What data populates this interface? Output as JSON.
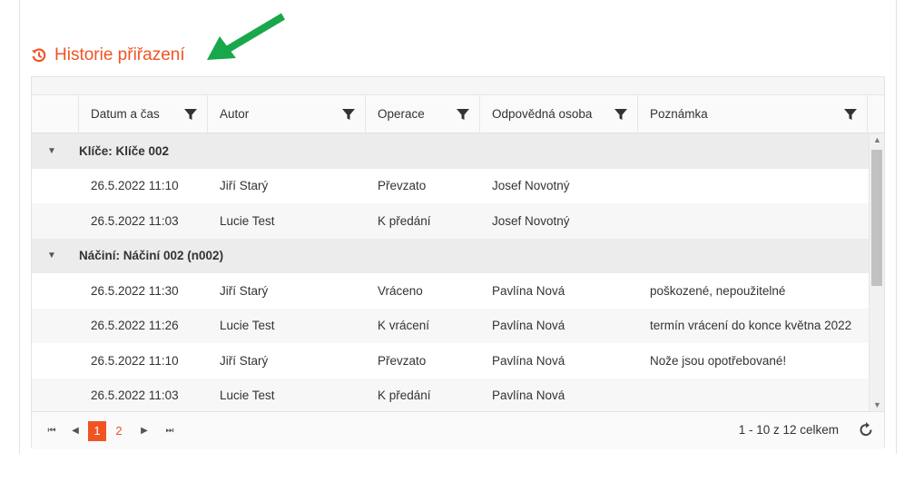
{
  "section": {
    "title": "Historie přiřazení",
    "icon": "history-icon"
  },
  "colors": {
    "accent": "#f05423",
    "arrow": "#18a84b"
  },
  "columns": [
    "Datum a čas",
    "Autor",
    "Operace",
    "Odpovědná osoba",
    "Poznámka"
  ],
  "groups": [
    {
      "label": "Klíče: Klíče 002",
      "rows": [
        {
          "datum": "26.5.2022 11:10",
          "autor": "Jiří Starý",
          "operace": "Převzato",
          "osoba": "Josef Novotný",
          "poznamka": ""
        },
        {
          "datum": "26.5.2022 11:03",
          "autor": "Lucie Test",
          "operace": "K předání",
          "osoba": "Josef Novotný",
          "poznamka": ""
        }
      ]
    },
    {
      "label": "Náčiní: Náčiní 002 (n002)",
      "rows": [
        {
          "datum": "26.5.2022 11:30",
          "autor": "Jiří Starý",
          "operace": "Vráceno",
          "osoba": "Pavlína Nová",
          "poznamka": "poškozené, nepoužitelné"
        },
        {
          "datum": "26.5.2022 11:26",
          "autor": "Lucie Test",
          "operace": "K vrácení",
          "osoba": "Pavlína Nová",
          "poznamka": "termín vrácení do konce května 2022"
        },
        {
          "datum": "26.5.2022 11:10",
          "autor": "Jiří Starý",
          "operace": "Převzato",
          "osoba": "Pavlína Nová",
          "poznamka": "Nože jsou opotřebované!"
        },
        {
          "datum": "26.5.2022 11:03",
          "autor": "Lucie Test",
          "operace": "K předání",
          "osoba": "Pavlína Nová",
          "poznamka": ""
        }
      ]
    }
  ],
  "pager": {
    "pages": [
      "1",
      "2"
    ],
    "current": "1",
    "info": "1 - 10 z 12 celkem"
  }
}
